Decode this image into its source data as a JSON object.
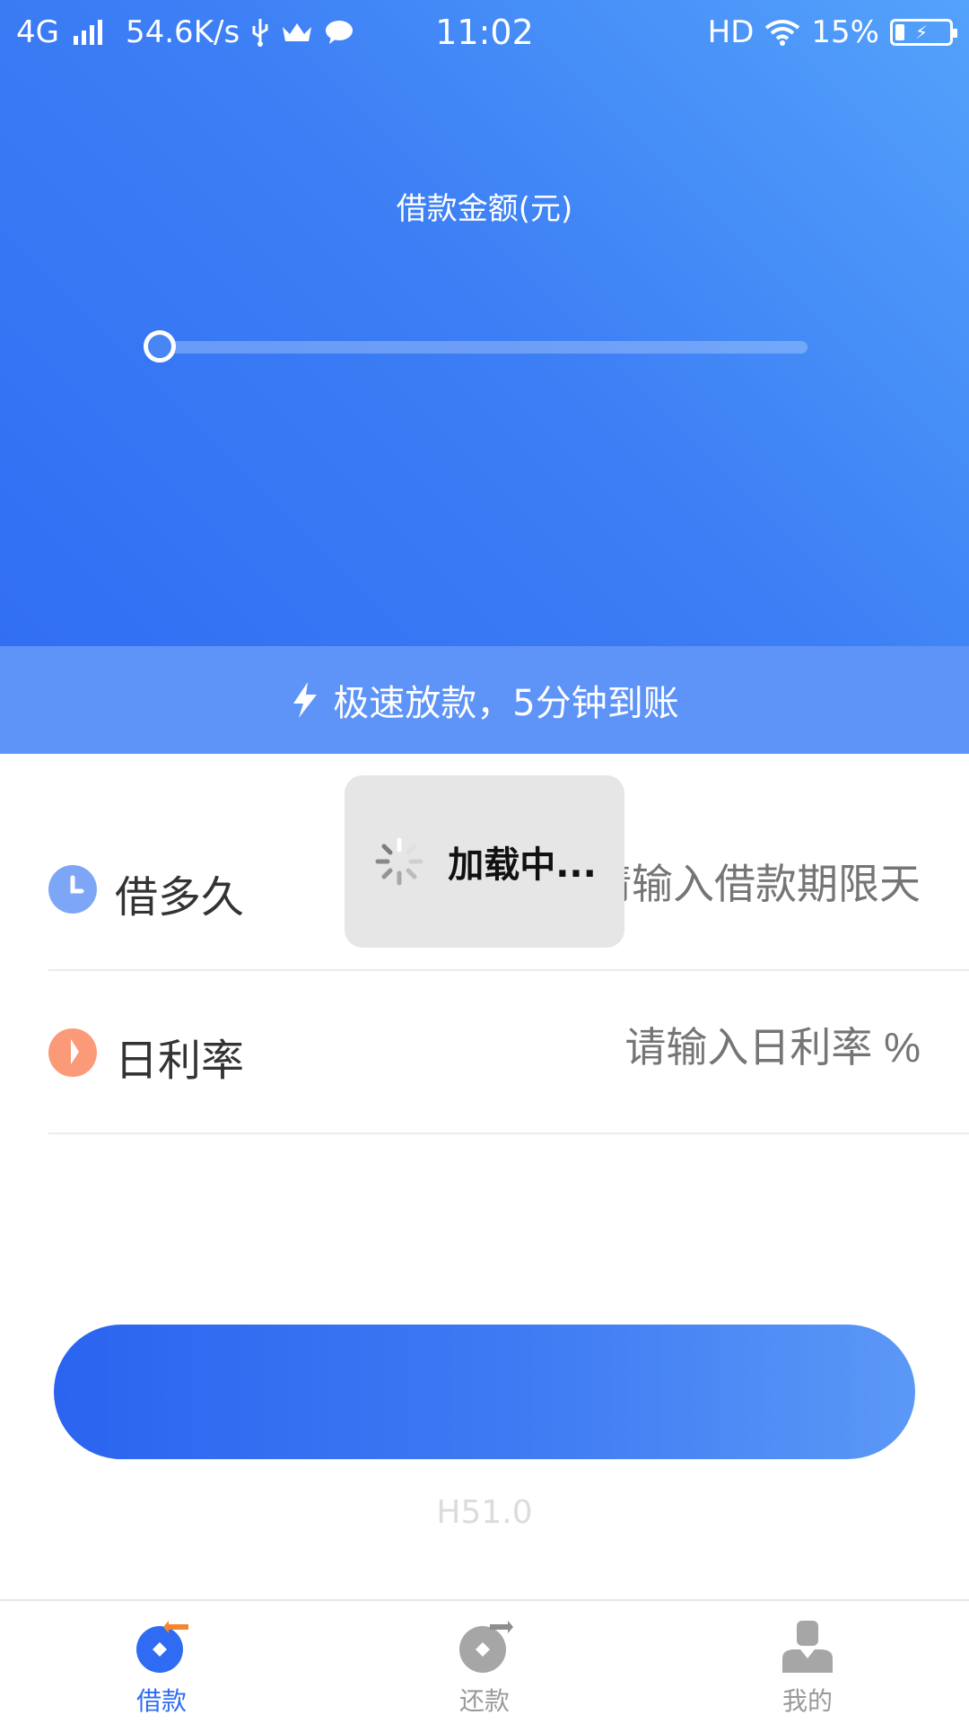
{
  "status_bar": {
    "network": "4G",
    "speed": "54.6K/s",
    "time": "11:02",
    "hd": "HD",
    "battery_percent": "15%"
  },
  "hero": {
    "amount_label": "借款金额(元)",
    "slider_value_fraction": 0.0
  },
  "promo": {
    "text": "极速放款，5分钟到账"
  },
  "form": {
    "rows": [
      {
        "label": "借多久",
        "placeholder": "请输入借款期限天",
        "icon": "clock-icon",
        "icon_color": "#7ea6f7"
      },
      {
        "label": "日利率",
        "placeholder": "请输入日利率 %",
        "icon": "rate-icon",
        "icon_color": "#fb9a78"
      }
    ]
  },
  "loading": {
    "text": "加载中..."
  },
  "main_button": {
    "label": ""
  },
  "version": "H51.0",
  "tabs": [
    {
      "label": "借款",
      "icon": "borrow-icon",
      "active": true,
      "color": "#2f6cf3"
    },
    {
      "label": "还款",
      "icon": "repay-icon",
      "active": false,
      "color": "#9a9a9a"
    },
    {
      "label": "我的",
      "icon": "profile-icon",
      "active": false,
      "color": "#9a9a9a"
    }
  ],
  "colors": {
    "accent": "#2f6cf3",
    "hero_light": "#53a2fb",
    "placeholder": "#a8a8a8"
  }
}
